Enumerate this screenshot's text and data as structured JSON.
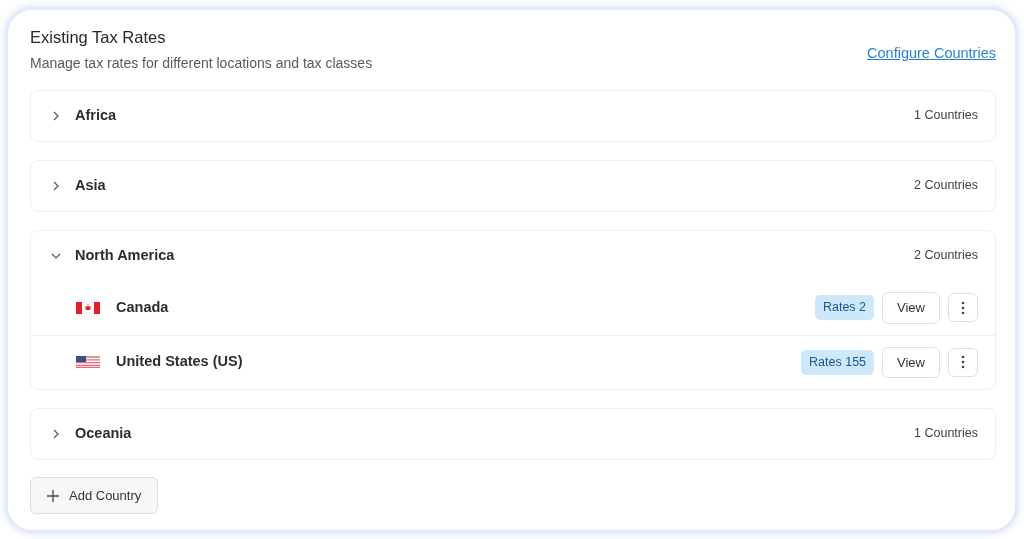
{
  "header": {
    "title": "Existing Tax Rates",
    "subtitle": "Manage tax rates for different locations and tax classes",
    "link": "Configure Countries"
  },
  "regions": [
    {
      "name": "Africa",
      "count": "1 Countries",
      "expanded": false
    },
    {
      "name": "Asia",
      "count": "2 Countries",
      "expanded": false
    },
    {
      "name": "North America",
      "count": "2 Countries",
      "expanded": true,
      "countries": [
        {
          "kind": "ca",
          "name": "Canada",
          "rates": "Rates 2",
          "button": "View"
        },
        {
          "kind": "us",
          "name": "United States (US)",
          "rates": "Rates 155",
          "button": "View"
        }
      ]
    },
    {
      "name": "Oceania",
      "count": "1 Countries",
      "expanded": false
    }
  ],
  "add_button": "Add Country"
}
